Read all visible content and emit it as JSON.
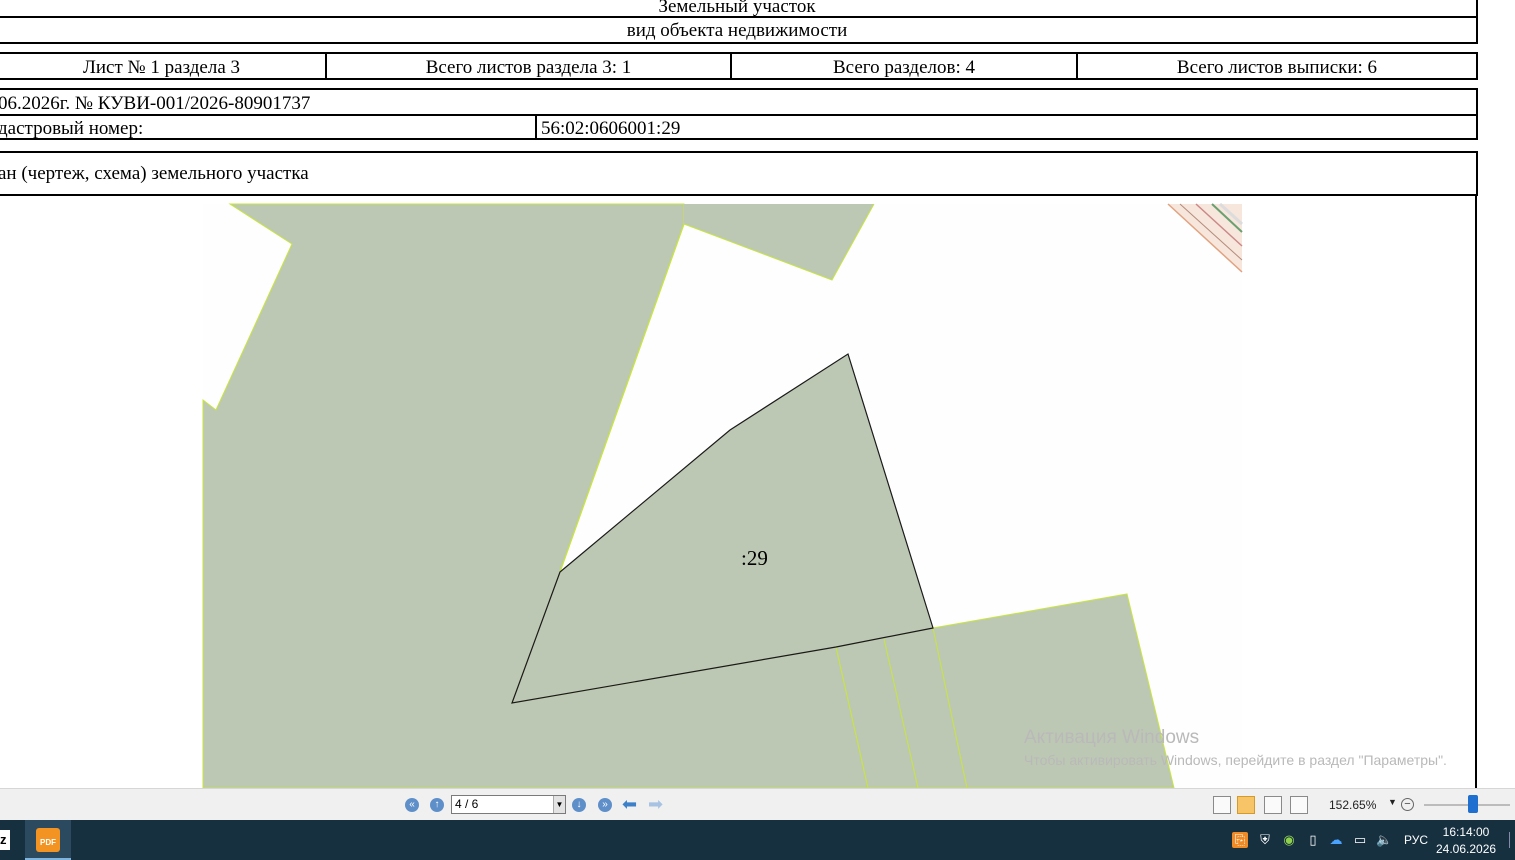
{
  "document": {
    "header": {
      "title": "Земельный участок",
      "subtitle": "вид объекта недвижимости"
    },
    "sheet_info": {
      "sheet": "Лист № 1 раздела 3",
      "total_sheets_section": "Всего листов раздела 3: 1",
      "total_sections": "Всего разделов: 4",
      "total_sheets_extract": "Всего листов выписки: 6"
    },
    "extract_number": "06.2026г. № КУВИ-001/2026-80901737",
    "cadastral_label": "дастровый номер:",
    "cadastral_value": "56:02:0606001:29",
    "plan_title": "ан (чертеж, схема) земельного участка",
    "parcel_label": ":29"
  },
  "watermark": {
    "line1": "Активация Windows",
    "line2": "Чтобы активировать Windows, перейдите в раздел \"Параметры\"."
  },
  "viewer": {
    "page_indicator": "4 / 6",
    "zoom": "152.65%"
  },
  "taskbar": {
    "partial_app": "z",
    "language": "РУС",
    "time": "16:14:00",
    "date": "24.06.2026"
  },
  "colors": {
    "parcel_fill": "#bdc8b4",
    "border_yellow": "#c8e63c",
    "taskbar": "#163040",
    "slider": "#1f6fd1"
  }
}
